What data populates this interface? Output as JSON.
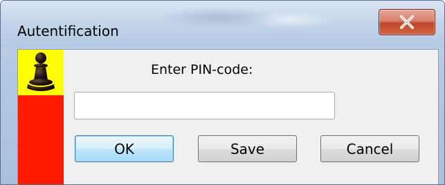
{
  "window": {
    "title": "Autentification",
    "close_icon": "close-x-icon"
  },
  "dialog": {
    "prompt": "Enter PIN-code:",
    "pin_input": {
      "value": "",
      "placeholder": ""
    },
    "banner_icon": "chess-pawn-icon",
    "buttons": {
      "ok": "OK",
      "save": "Save",
      "cancel": "Cancel"
    }
  },
  "colors": {
    "banner_red": "#ff1a00",
    "banner_yellow": "#ffff00",
    "close_button": "#c0442c",
    "titlebar": "#c4d5ea"
  }
}
